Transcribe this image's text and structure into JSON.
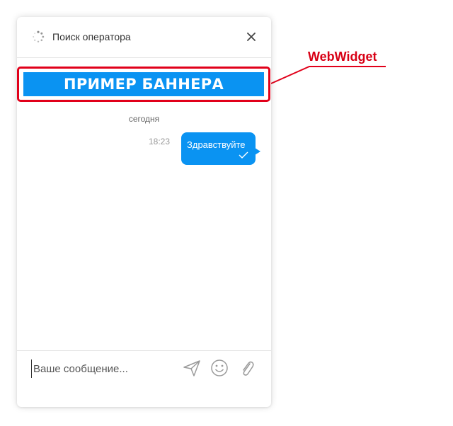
{
  "header": {
    "status_title": "Поиск оператора",
    "spinner_icon": "loading-spinner-icon",
    "close_icon": "close-icon"
  },
  "banner": {
    "text": "ПРИМЕР БАННЕРА",
    "background": "#0a93f2"
  },
  "callout": {
    "label": "WebWidget",
    "color": "#e1001a"
  },
  "chat": {
    "date_separator": "сегодня",
    "messages": [
      {
        "text": "Здравствуйте",
        "time": "18:23",
        "status_icon": "check-icon"
      }
    ]
  },
  "composer": {
    "placeholder": "Ваше сообщение...",
    "send_icon": "send-icon",
    "emoji_icon": "emoji-icon",
    "attach_icon": "paperclip-icon"
  },
  "colors": {
    "accent": "#0a93f2",
    "annotation_red": "#e1001a"
  }
}
